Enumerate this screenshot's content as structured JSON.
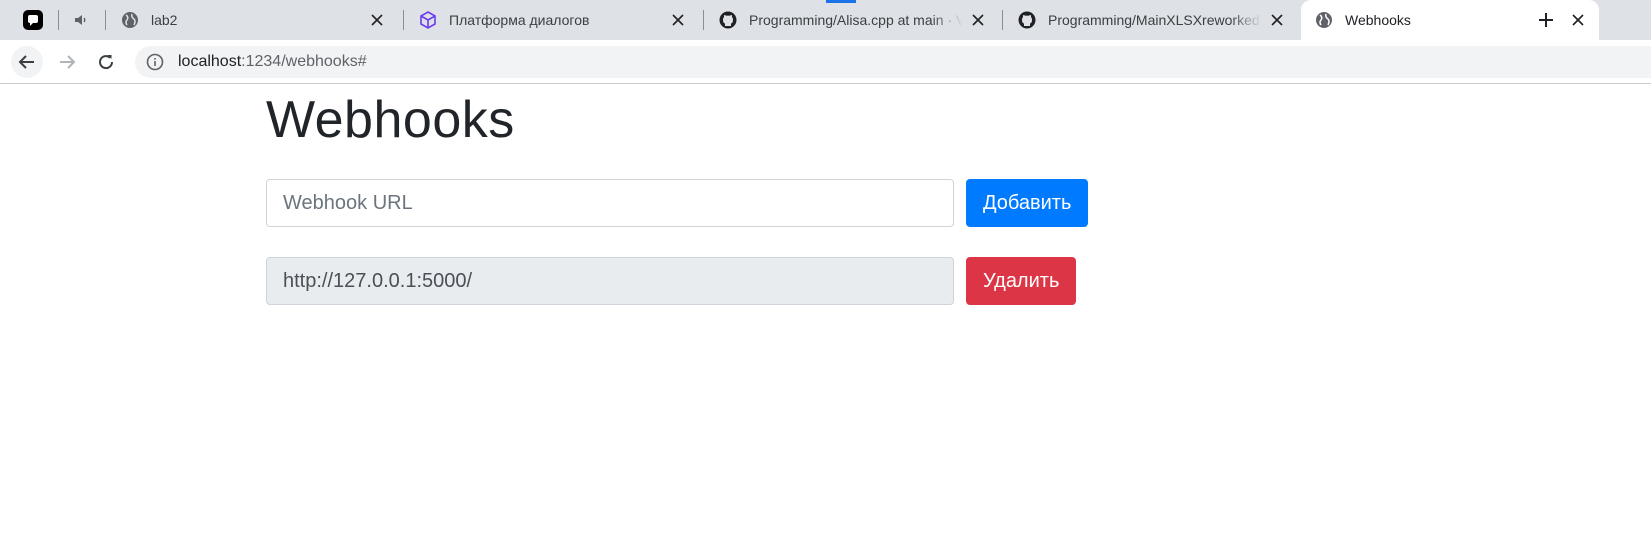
{
  "browser": {
    "tabs": [
      {
        "title": "lab2",
        "favicon": "globe-icon",
        "active": false
      },
      {
        "title": "Платформа диалогов",
        "favicon": "cube-icon",
        "active": false
      },
      {
        "title": "Programming/Alisa.cpp at main · Vasilev-Dmitry/Programming",
        "favicon": "github-icon",
        "active": false
      },
      {
        "title": "Programming/MainXLSXreworked.cpp at main · Vasilev-Dmitry",
        "favicon": "github-icon",
        "active": false
      },
      {
        "title": "Webhooks",
        "favicon": "globe-icon",
        "active": true
      }
    ],
    "address_bar": {
      "host": "localhost",
      "path": ":1234/webhooks#"
    }
  },
  "page": {
    "title": "Webhooks",
    "add_form": {
      "placeholder": "Webhook URL",
      "value": "",
      "button_label": "Добавить"
    },
    "webhooks": [
      {
        "url": "http://127.0.0.1:5000/",
        "button_label": "Удалить"
      }
    ]
  },
  "colors": {
    "primary": "#007bff",
    "danger": "#dc3545",
    "heading": "#212529",
    "tabstrip": "#dee1e6"
  }
}
